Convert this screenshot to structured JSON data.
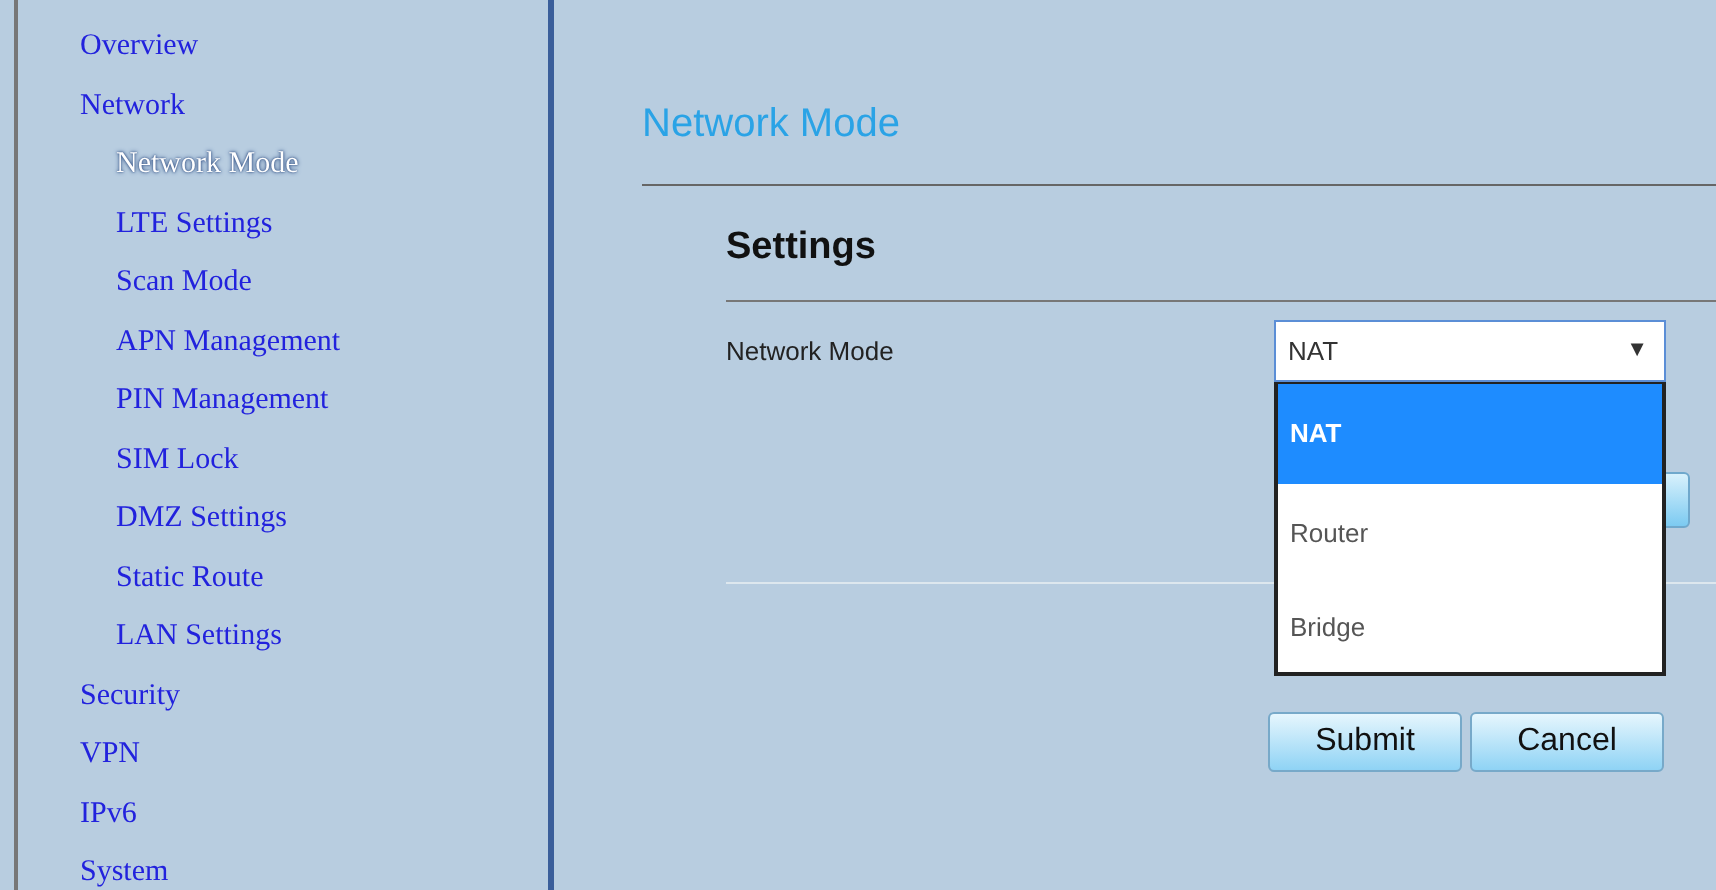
{
  "sidebar": {
    "items": [
      {
        "label": "Overview",
        "selected": false
      },
      {
        "label": "Network",
        "selected": false,
        "children": [
          {
            "label": "Network Mode",
            "selected": true
          },
          {
            "label": "LTE Settings",
            "selected": false
          },
          {
            "label": "Scan Mode",
            "selected": false
          },
          {
            "label": "APN Management",
            "selected": false
          },
          {
            "label": "PIN Management",
            "selected": false
          },
          {
            "label": "SIM Lock",
            "selected": false
          },
          {
            "label": "DMZ Settings",
            "selected": false
          },
          {
            "label": "Static Route",
            "selected": false
          },
          {
            "label": "LAN Settings",
            "selected": false
          }
        ]
      },
      {
        "label": "Security",
        "selected": false
      },
      {
        "label": "VPN",
        "selected": false
      },
      {
        "label": "IPv6",
        "selected": false
      },
      {
        "label": "System",
        "selected": false
      }
    ]
  },
  "page_title": "Network Mode",
  "section_title": "Settings",
  "field": {
    "label": "Network Mode",
    "value": "NAT",
    "caret": "▼",
    "expanded": true,
    "options": [
      {
        "label": "NAT",
        "selected": true
      },
      {
        "label": "Router",
        "selected": false
      },
      {
        "label": "Bridge",
        "selected": false
      }
    ]
  },
  "buttons": [
    "Submit",
    "Cancel"
  ]
}
